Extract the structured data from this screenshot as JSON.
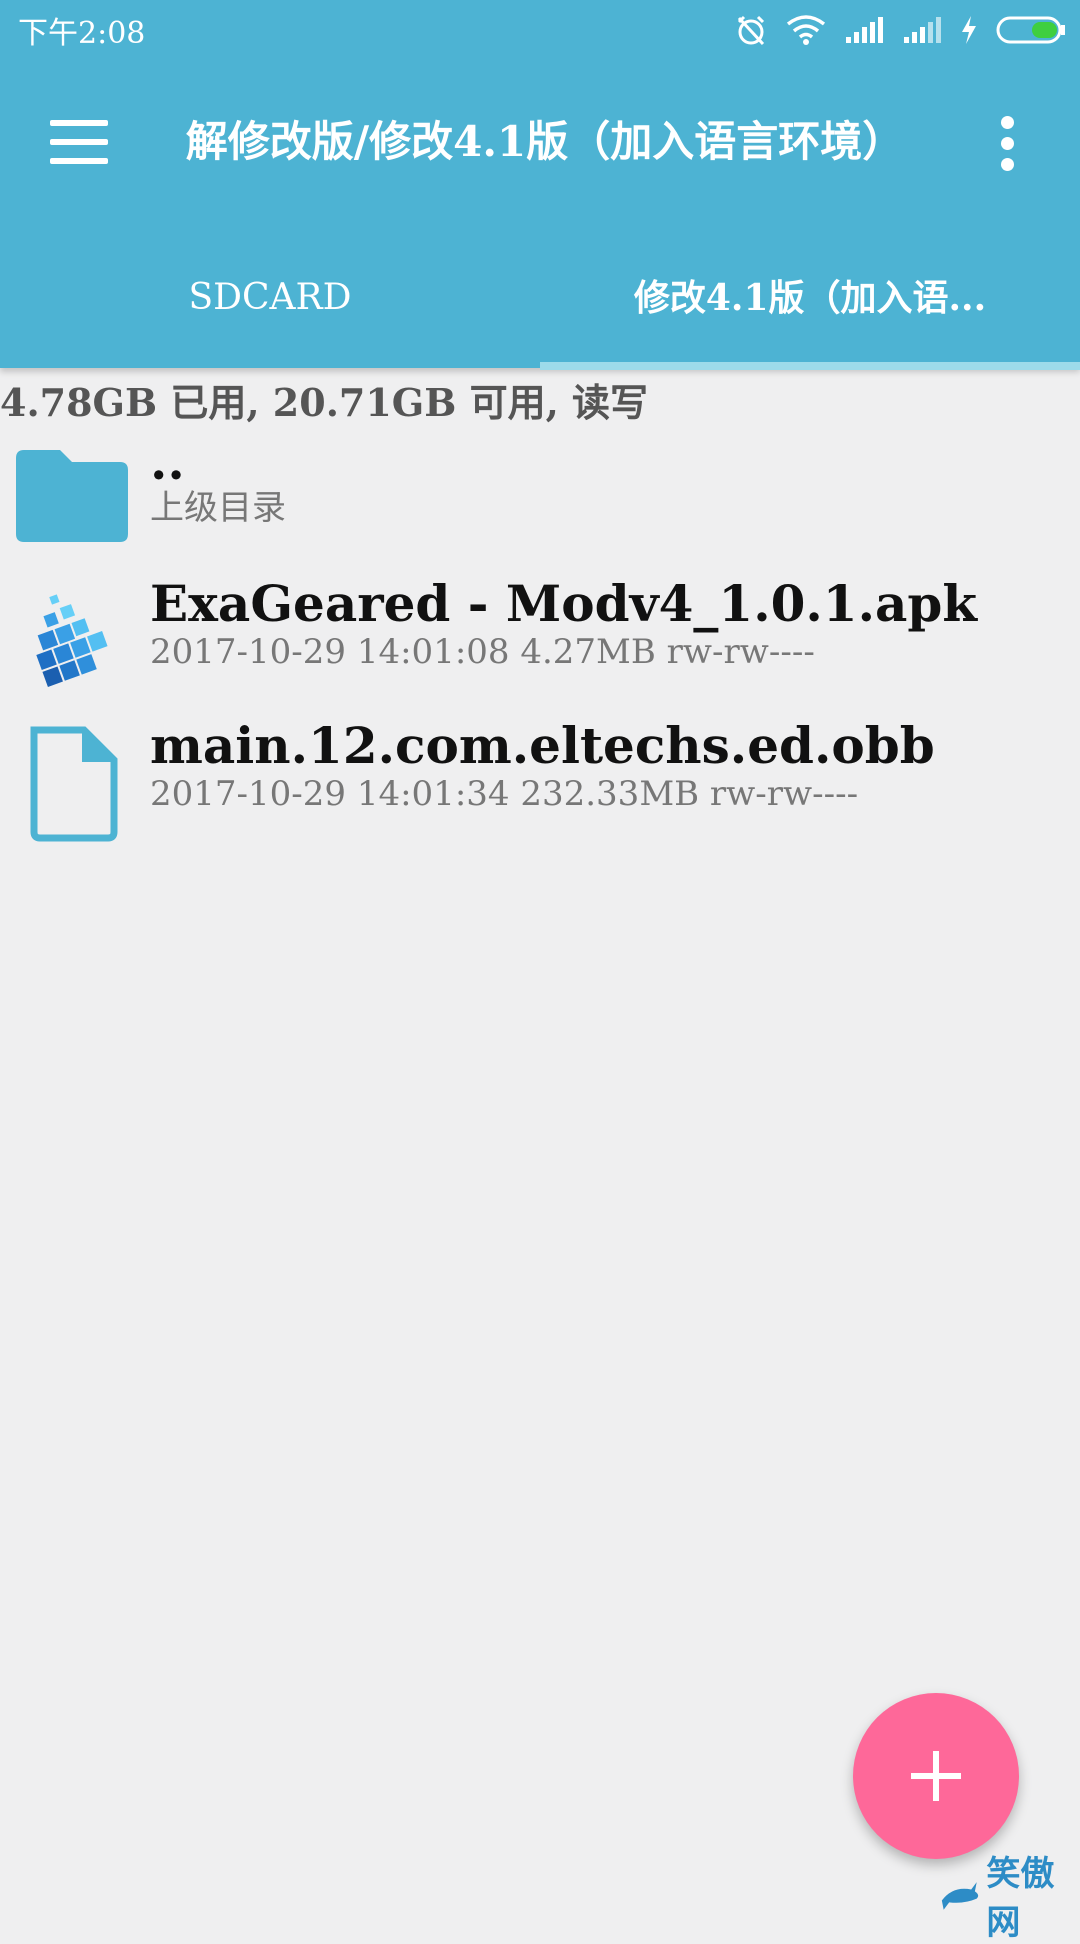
{
  "status_bar": {
    "time": "下午2:08"
  },
  "toolbar": {
    "title": "解修改版/修改4.1版（加入语言环境）"
  },
  "tabs": [
    {
      "label": "SDCARD",
      "selected": false
    },
    {
      "label": "修改4.1版（加入语...",
      "selected": true
    }
  ],
  "storage_info": "4.78GB 已用, 20.71GB 可用, 读写",
  "files": [
    {
      "name": "..",
      "meta": "上级目录",
      "icon": "folder-icon"
    },
    {
      "name": "ExaGeared - Modv4_1.0.1.apk",
      "meta": "2017-10-29 14:01:08  4.27MB  rw-rw----",
      "icon": "apk-icon"
    },
    {
      "name": "main.12.com.eltechs.ed.obb",
      "meta": "2017-10-29 14:01:34  232.33MB  rw-rw----",
      "icon": "file-icon"
    }
  ],
  "watermark": "笑傲网",
  "colors": {
    "appbar": "#4db3d3",
    "fab": "#fe6899",
    "tab_indicator": "#9ddbea",
    "background": "#efeff0"
  }
}
